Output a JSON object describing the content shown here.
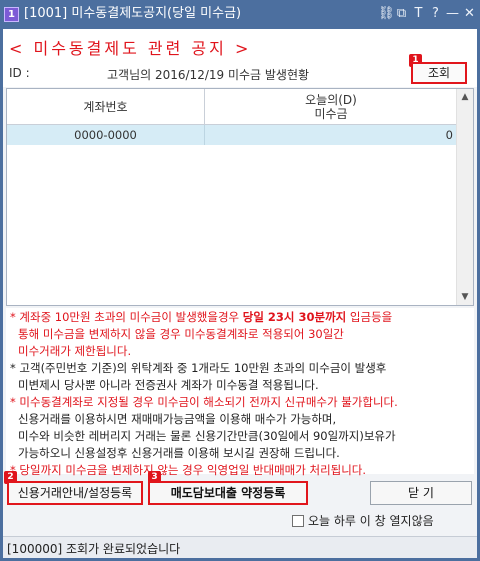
{
  "window": {
    "number_badge": "1",
    "title": "[1001] 미수동결제도공지(당일 미수금)",
    "icons": [
      "link-icon",
      "window-icon",
      "text-icon",
      "help-icon",
      "minimize-icon",
      "close-icon"
    ],
    "icon_glyphs": [
      "⛓",
      "⧉",
      "T",
      "?",
      "—",
      "✕"
    ]
  },
  "header": {
    "title": "< 미수동결제도 관련 공지 >",
    "id_label": "ID :",
    "info": "고객님의 2016/12/19 미수금 발생현황",
    "query_button": "조회",
    "query_badge": "1"
  },
  "grid": {
    "columns": [
      "계좌번호",
      "오늘의(D)",
      "미수금"
    ],
    "rows": [
      {
        "account": "0000-0000",
        "amount": "0"
      }
    ]
  },
  "notices": [
    {
      "bullet": "*",
      "color": "red",
      "parts": [
        "계좌중 10만원 초과의 미수금이 발생했을경우 ",
        "당일 23시 30분까지",
        " 입금등을"
      ]
    },
    {
      "bullet": "",
      "color": "red",
      "parts": [
        "통해 미수금을 변제하지 않을 경우 미수동결계좌로 적용되어 30일간"
      ]
    },
    {
      "bullet": "",
      "color": "red",
      "parts": [
        "미수거래가 제한됩니다."
      ]
    },
    {
      "bullet": "*",
      "color": "black",
      "parts": [
        "고객(주민번호 기준)의 위탁계좌 중 1개라도 10만원 초과의 미수금이 발생후"
      ]
    },
    {
      "bullet": "",
      "color": "black",
      "parts": [
        "미변제시 당사뿐 아니라 전증권사 계좌가 미수동결 적용됩니다."
      ]
    },
    {
      "bullet": "*",
      "color": "red",
      "parts": [
        "미수동결계좌로 지정될 경우 미수금이 해소되기 전까지 신규매수가 불가합니다."
      ]
    },
    {
      "bullet": "",
      "color": "black",
      "parts": [
        "신용거래를 이용하시면 재매매가능금액을 이용해 매수가 가능하며,"
      ]
    },
    {
      "bullet": "",
      "color": "black",
      "parts": [
        "미수와 비슷한 레버리지 거래는 물론 신용기간만큼(30일에서 90일까지)보유가"
      ]
    },
    {
      "bullet": "",
      "color": "black",
      "parts": [
        "가능하오니 신용설정후 신용거래를 이용해 보시길 권장해 드립니다."
      ]
    },
    {
      "bullet": "*",
      "color": "red",
      "parts": [
        "당일까지 미수금을 변제하지 않는 경우 익영업일 반대매매가 처리됩니다."
      ]
    }
  ],
  "buttons": {
    "credit": "신용거래안내/설정등록",
    "credit_badge": "2",
    "loan": "매도담보대출 약정등록",
    "loan_badge": "3",
    "close": "닫 기"
  },
  "hide_today": "오늘 하루 이 창 열지않음",
  "status": "[100000] 조회가 완료되었습니다",
  "colors": {
    "frame": "#4c6f9f",
    "accent_red": "#e0141c",
    "row_highlight": "#d6ecf6"
  }
}
